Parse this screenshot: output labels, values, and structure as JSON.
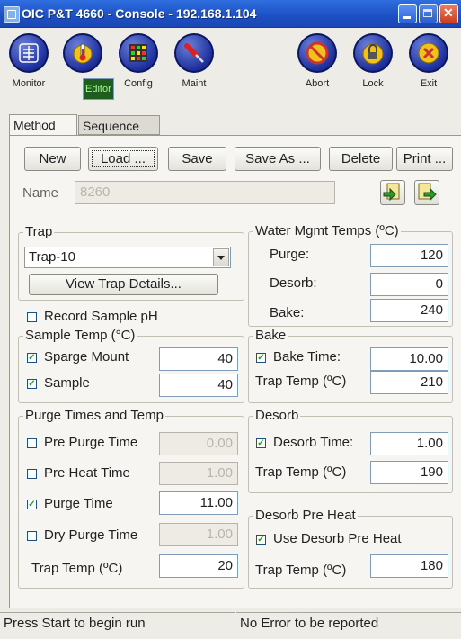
{
  "window": {
    "title": "OIC P&T 4660 - Console - 192.168.1.104",
    "app_icon": "console-icon"
  },
  "toolbar": {
    "items": [
      {
        "label": "Monitor",
        "icon": "monitor-icon",
        "selected": false
      },
      {
        "label": "Editor",
        "icon": "thermometer-icon",
        "selected": true
      },
      {
        "label": "Config",
        "icon": "grid-icon",
        "selected": false
      },
      {
        "label": "Maint",
        "icon": "screwdriver-icon",
        "selected": false
      },
      {
        "label": "Abort",
        "icon": "abort-icon",
        "selected": false
      },
      {
        "label": "Lock",
        "icon": "lock-icon",
        "selected": false
      },
      {
        "label": "Exit",
        "icon": "exit-icon",
        "selected": false
      }
    ]
  },
  "tabs": {
    "method": "Method",
    "sequence": "Sequence"
  },
  "actions": {
    "new": "New",
    "load": "Load ...",
    "save": "Save",
    "save_as": "Save As ...",
    "delete": "Delete",
    "print": "Print ..."
  },
  "name": {
    "label": "Name",
    "value": "8260"
  },
  "trap": {
    "legend": "Trap",
    "selected": "Trap-10",
    "details_button": "View Trap Details..."
  },
  "water": {
    "legend": "Water Mgmt Temps (ºC)",
    "purge_label": "Purge:",
    "purge_value": "120",
    "desorb_label": "Desorb:",
    "desorb_value": "0",
    "bake_label": "Bake:",
    "bake_value": "240"
  },
  "record_ph": {
    "label": "Record Sample pH",
    "checked": false
  },
  "sample_temp": {
    "legend": "Sample Temp (°C)",
    "sparge_label": "Sparge Mount",
    "sparge_value": "40",
    "sparge_checked": true,
    "sample_label": "Sample",
    "sample_value": "40",
    "sample_checked": true
  },
  "bake": {
    "legend": "Bake",
    "time_label": "Bake Time:",
    "time_value": "10.00",
    "time_checked": true,
    "trap_label": "Trap Temp (ºC)",
    "trap_value": "210"
  },
  "purge": {
    "legend": "Purge Times and Temp",
    "pre_purge_label": "Pre Purge Time",
    "pre_purge_value": "0.00",
    "pre_purge_checked": false,
    "pre_heat_label": "Pre Heat Time",
    "pre_heat_value": "1.00",
    "pre_heat_checked": false,
    "purge_label": "Purge Time",
    "purge_value": "11.00",
    "purge_checked": true,
    "dry_label": "Dry Purge Time",
    "dry_value": "1.00",
    "dry_checked": false,
    "trap_label": "Trap Temp (ºC)",
    "trap_value": "20"
  },
  "desorb": {
    "legend": "Desorb",
    "time_label": "Desorb Time:",
    "time_value": "1.00",
    "time_checked": true,
    "trap_label": "Trap Temp (ºC)",
    "trap_value": "190"
  },
  "preheat": {
    "legend": "Desorb Pre Heat",
    "use_label": "Use Desorb Pre Heat",
    "use_checked": true,
    "trap_label": "Trap Temp (ºC)",
    "trap_value": "180"
  },
  "status": {
    "left": "Press Start to begin run",
    "right": "No Error to be reported"
  },
  "colors": {
    "titlebar": "#2463d6",
    "toolbar_button": "#1e2f9c",
    "selected_label_bg": "#1f5c1f",
    "selected_label_fg": "#9fff7f"
  }
}
